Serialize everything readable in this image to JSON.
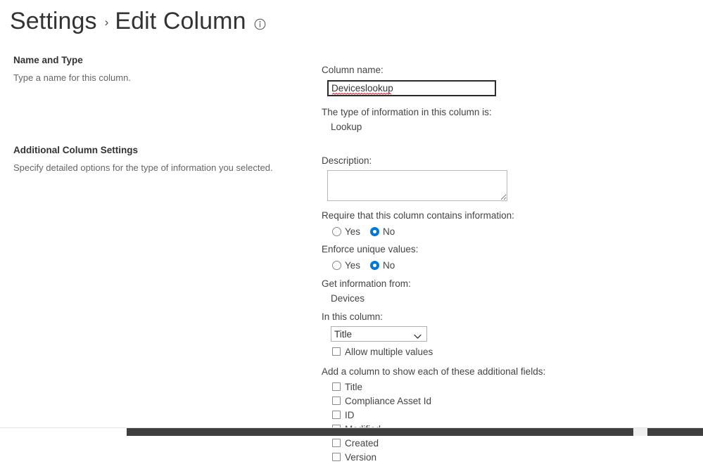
{
  "header": {
    "title_main": "Settings",
    "separator": "›",
    "title_sub": "Edit Column",
    "info_icon": "info-circle-icon"
  },
  "sections": {
    "name_and_type": {
      "title": "Name and Type",
      "description": "Type a name for this column."
    },
    "additional_settings": {
      "title": "Additional Column Settings",
      "description": "Specify detailed options for the type of information you selected."
    }
  },
  "fields": {
    "column_name": {
      "label": "Column name:",
      "value": "Deviceslookup",
      "placeholder": ""
    },
    "type_of_information": {
      "label": "The type of information in this column is:",
      "value": "Lookup"
    },
    "description": {
      "label": "Description:",
      "value": "",
      "placeholder": ""
    },
    "require_information": {
      "label": "Require that this column contains information:",
      "options": [
        "Yes",
        "No"
      ],
      "selected": "No"
    },
    "enforce_unique": {
      "label": "Enforce unique values:",
      "options": [
        "Yes",
        "No"
      ],
      "selected": "No"
    },
    "get_information_from": {
      "label": "Get information from:",
      "value": "Devices"
    },
    "in_this_column": {
      "label": "In this column:",
      "selected": "Title",
      "options": [
        "Title"
      ]
    },
    "allow_multiple_values": {
      "label": "Allow multiple values",
      "checked": false
    },
    "additional_fields": {
      "label": "Add a column to show each of these additional fields:",
      "items": [
        {
          "label": "Title",
          "checked": false
        },
        {
          "label": "Compliance Asset Id",
          "checked": false
        },
        {
          "label": "ID",
          "checked": false
        },
        {
          "label": "Modified",
          "checked": false
        },
        {
          "label": "Created",
          "checked": false
        },
        {
          "label": "Version",
          "checked": false
        }
      ]
    }
  },
  "colors": {
    "accent": "#0078d4",
    "text": "#444444",
    "muted": "#666666",
    "spellcheck": "#e81123",
    "scrollbar": "#3f3f3f"
  }
}
